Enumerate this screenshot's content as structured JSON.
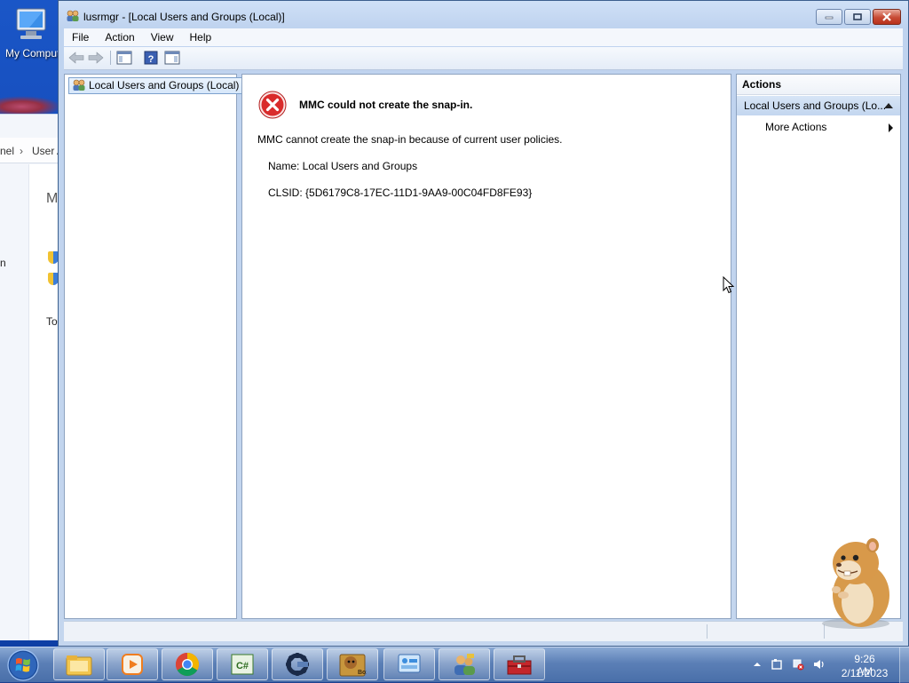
{
  "desktop": {
    "icon_label": "My Computer",
    "icon_label_visible": "My Comput"
  },
  "background_window": {
    "crumb1": "nel",
    "crumb2": "User A",
    "heading_fragment": "M",
    "item_fragment": "n",
    "link_fragment": "To"
  },
  "window": {
    "title": "lusrmgr - [Local Users and Groups (Local)]",
    "menu": [
      "File",
      "Action",
      "View",
      "Help"
    ],
    "toolbar_icons": [
      "back-arrow-icon",
      "forward-arrow-icon",
      "show-hide-console-tree-icon",
      "help-icon",
      "show-hide-action-pane-icon"
    ]
  },
  "tree": {
    "root_label": "Local Users and Groups (Local)"
  },
  "error": {
    "title": "MMC could not create the snap-in.",
    "message": "MMC cannot create the snap-in because of current user policies.",
    "name_line": "Name: Local Users and Groups",
    "clsid_line": "CLSID: {5D6179C8-17EC-11D1-9AA9-00C04FD8FE93}"
  },
  "actions_pane": {
    "header": "Actions",
    "group_label": "Local Users and Groups (Lo...",
    "more_actions": "More Actions"
  },
  "taskbar": {
    "apps": [
      "windows-explorer",
      "media-player",
      "chrome",
      "csharp-editor",
      "cheat-engine",
      "box-app",
      "control-panel",
      "users-app",
      "toolbox-app"
    ],
    "clock_time": "9:26 AM",
    "clock_date": "2/11/2023"
  },
  "colors": {
    "error_red": "#d92b2b",
    "selection_blue": "#d6e7fa",
    "taskbar_blue": "#5b7fb6"
  }
}
